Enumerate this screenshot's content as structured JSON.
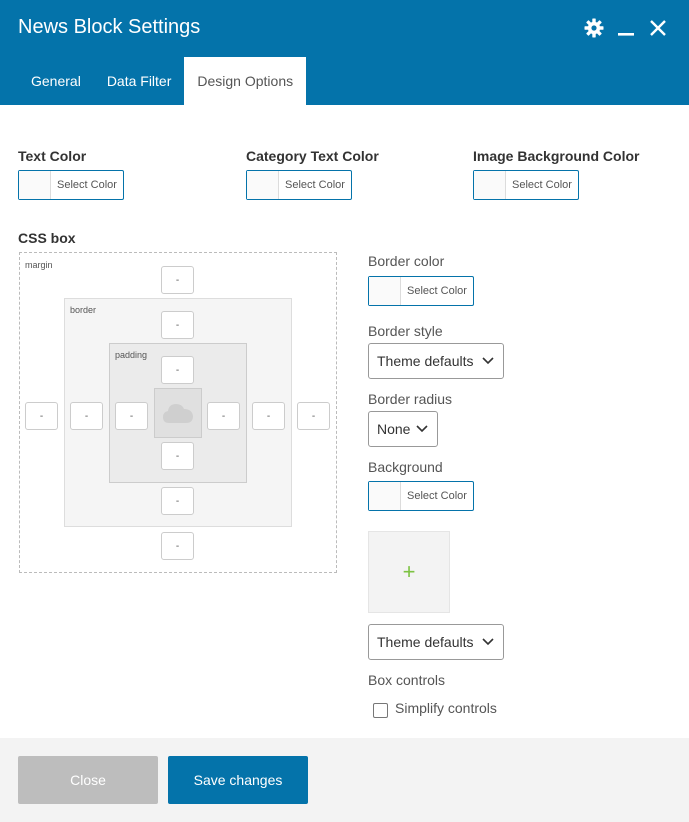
{
  "header": {
    "title": "News Block Settings",
    "icons": [
      "gear-icon",
      "minimize-icon",
      "close-icon"
    ],
    "tabs": [
      {
        "label": "General",
        "active": false
      },
      {
        "label": "Data Filter",
        "active": false
      },
      {
        "label": "Design Options",
        "active": true
      }
    ]
  },
  "colors": {
    "header_bg": "#0473aa",
    "accent": "#0473aa",
    "plus_green": "#7cc242",
    "close_btn_bg": "#bdbdbd"
  },
  "color_fields": [
    {
      "label": "Text Color",
      "button": "Select Color"
    },
    {
      "label": "Category Text Color",
      "button": "Select Color"
    },
    {
      "label": "Image Background Color",
      "button": "Select Color"
    }
  ],
  "css_box": {
    "label": "CSS box",
    "margin_label": "margin",
    "border_label": "border",
    "padding_label": "padding",
    "placeholder": "-"
  },
  "design": {
    "border_color_label": "Border color",
    "border_color_button": "Select Color",
    "border_style_label": "Border style",
    "border_style_value": "Theme defaults",
    "border_radius_label": "Border radius",
    "border_radius_value": "None",
    "background_label": "Background",
    "background_button": "Select Color",
    "upload_plus": "+",
    "background_style_value": "Theme defaults",
    "box_controls_label": "Box controls",
    "simplify_label": "Simplify controls"
  },
  "footer": {
    "close_label": "Close",
    "save_label": "Save changes"
  }
}
